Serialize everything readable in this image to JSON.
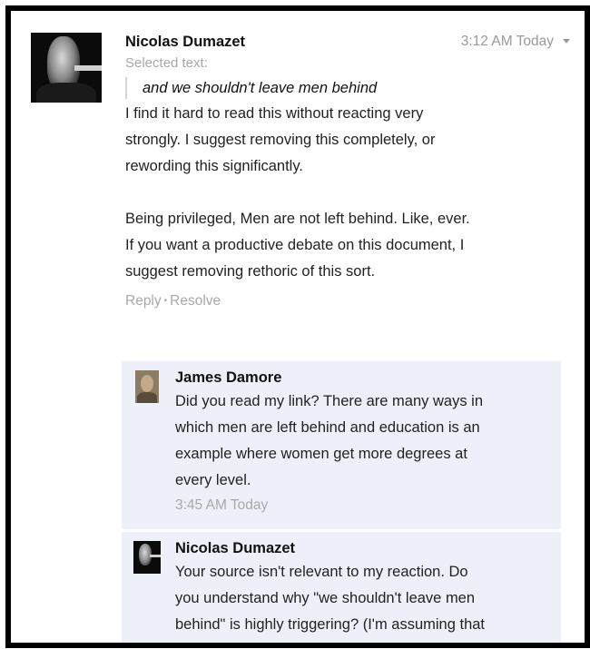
{
  "comment": {
    "author": "Nicolas Dumazet",
    "timestamp": "3:12 AM Today",
    "selected_label": "Selected text:",
    "quote": "and we shouldn't leave men behind",
    "lines": [
      "I find it hard to read this without reacting very",
      "strongly. I suggest removing this completely, or",
      "rewording this significantly."
    ],
    "lines2": [
      "Being privileged, Men are not left behind. Like, ever.",
      "If you want a productive debate on this document, I",
      "suggest removing rethoric of this sort."
    ],
    "reply_label": "Reply",
    "resolve_label": "Resolve",
    "separator": "•"
  },
  "replies": [
    {
      "author": "James Damore",
      "lines": [
        "Did you read my link? There are many ways in",
        "which men are left behind and education is an",
        "example where women get more degrees at",
        "every level."
      ],
      "time": "3:45 AM Today"
    },
    {
      "author": "Nicolas Dumazet",
      "lines": [
        "Your source isn't relevant to my reaction. Do",
        "you understand why \"we shouldn't leave men",
        "behind\" is highly triggering? (I'm assuming that"
      ]
    }
  ]
}
